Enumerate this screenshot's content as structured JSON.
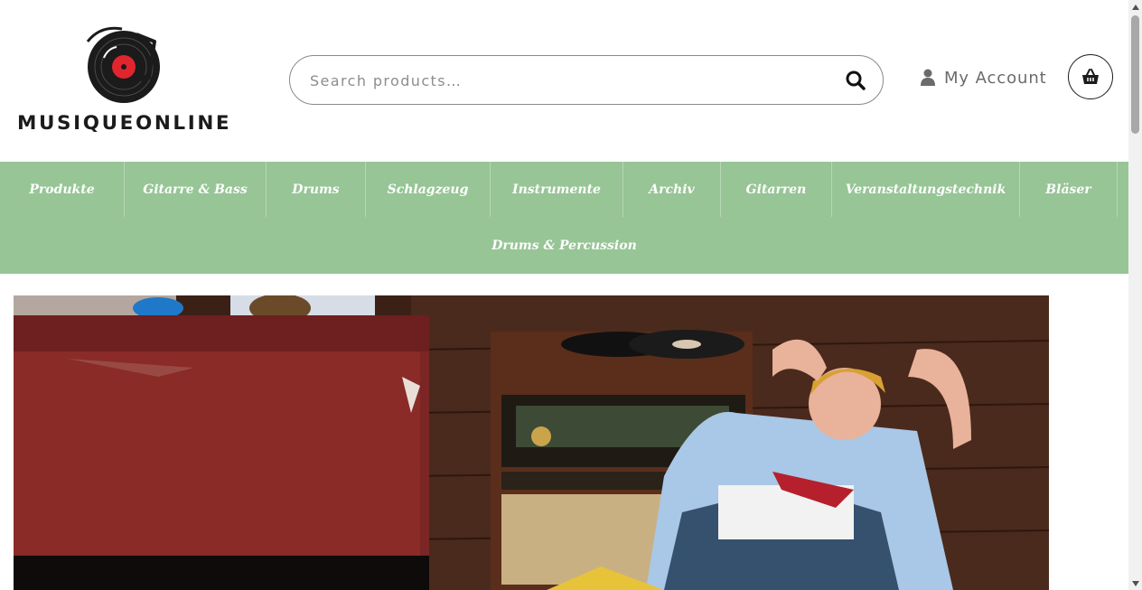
{
  "header": {
    "logo_text": "MUSIQUEONLINE",
    "search": {
      "placeholder": "Search products…",
      "value": ""
    },
    "account_label": "My Account",
    "cart_icon": "basket-icon"
  },
  "nav": {
    "row1": [
      "Produkte",
      "Gitarre & Bass",
      "Drums",
      "Schlagzeug",
      "Instrumente",
      "Archiv",
      "Gitarren",
      "Veranstaltungstechnik",
      "Bläser"
    ],
    "row2": [
      "Drums & Percussion"
    ]
  },
  "colors": {
    "nav_background": "#97c596",
    "nav_text": "#ffffff",
    "logo_accent": "#e0252f",
    "logo_dark": "#1b1b1b"
  },
  "icons": [
    "vinyl-record-logo-icon",
    "search-icon",
    "user-icon",
    "basket-icon",
    "scroll-up-arrow-icon",
    "scroll-down-arrow-icon"
  ]
}
